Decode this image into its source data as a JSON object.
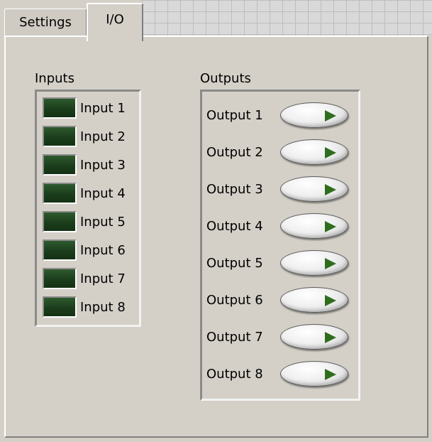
{
  "tabs": [
    {
      "label": "Settings",
      "active": false
    },
    {
      "label": "I/O",
      "active": true
    }
  ],
  "inputs": {
    "title": "Inputs",
    "items": [
      {
        "label": "Input 1",
        "state": "off"
      },
      {
        "label": "Input 2",
        "state": "off"
      },
      {
        "label": "Input 3",
        "state": "off"
      },
      {
        "label": "Input 4",
        "state": "off"
      },
      {
        "label": "Input 5",
        "state": "off"
      },
      {
        "label": "Input 6",
        "state": "off"
      },
      {
        "label": "Input 7",
        "state": "off"
      },
      {
        "label": "Input 8",
        "state": "off"
      }
    ]
  },
  "outputs": {
    "title": "Outputs",
    "items": [
      {
        "label": "Output 1",
        "state": "off"
      },
      {
        "label": "Output 2",
        "state": "off"
      },
      {
        "label": "Output 3",
        "state": "off"
      },
      {
        "label": "Output 4",
        "state": "off"
      },
      {
        "label": "Output 5",
        "state": "off"
      },
      {
        "label": "Output 6",
        "state": "off"
      },
      {
        "label": "Output 7",
        "state": "off"
      },
      {
        "label": "Output 8",
        "state": "off"
      }
    ]
  },
  "colors": {
    "panel": "#d4d0c8",
    "led_off": "#1b3d1b",
    "arrow": "#2f6d1e"
  }
}
